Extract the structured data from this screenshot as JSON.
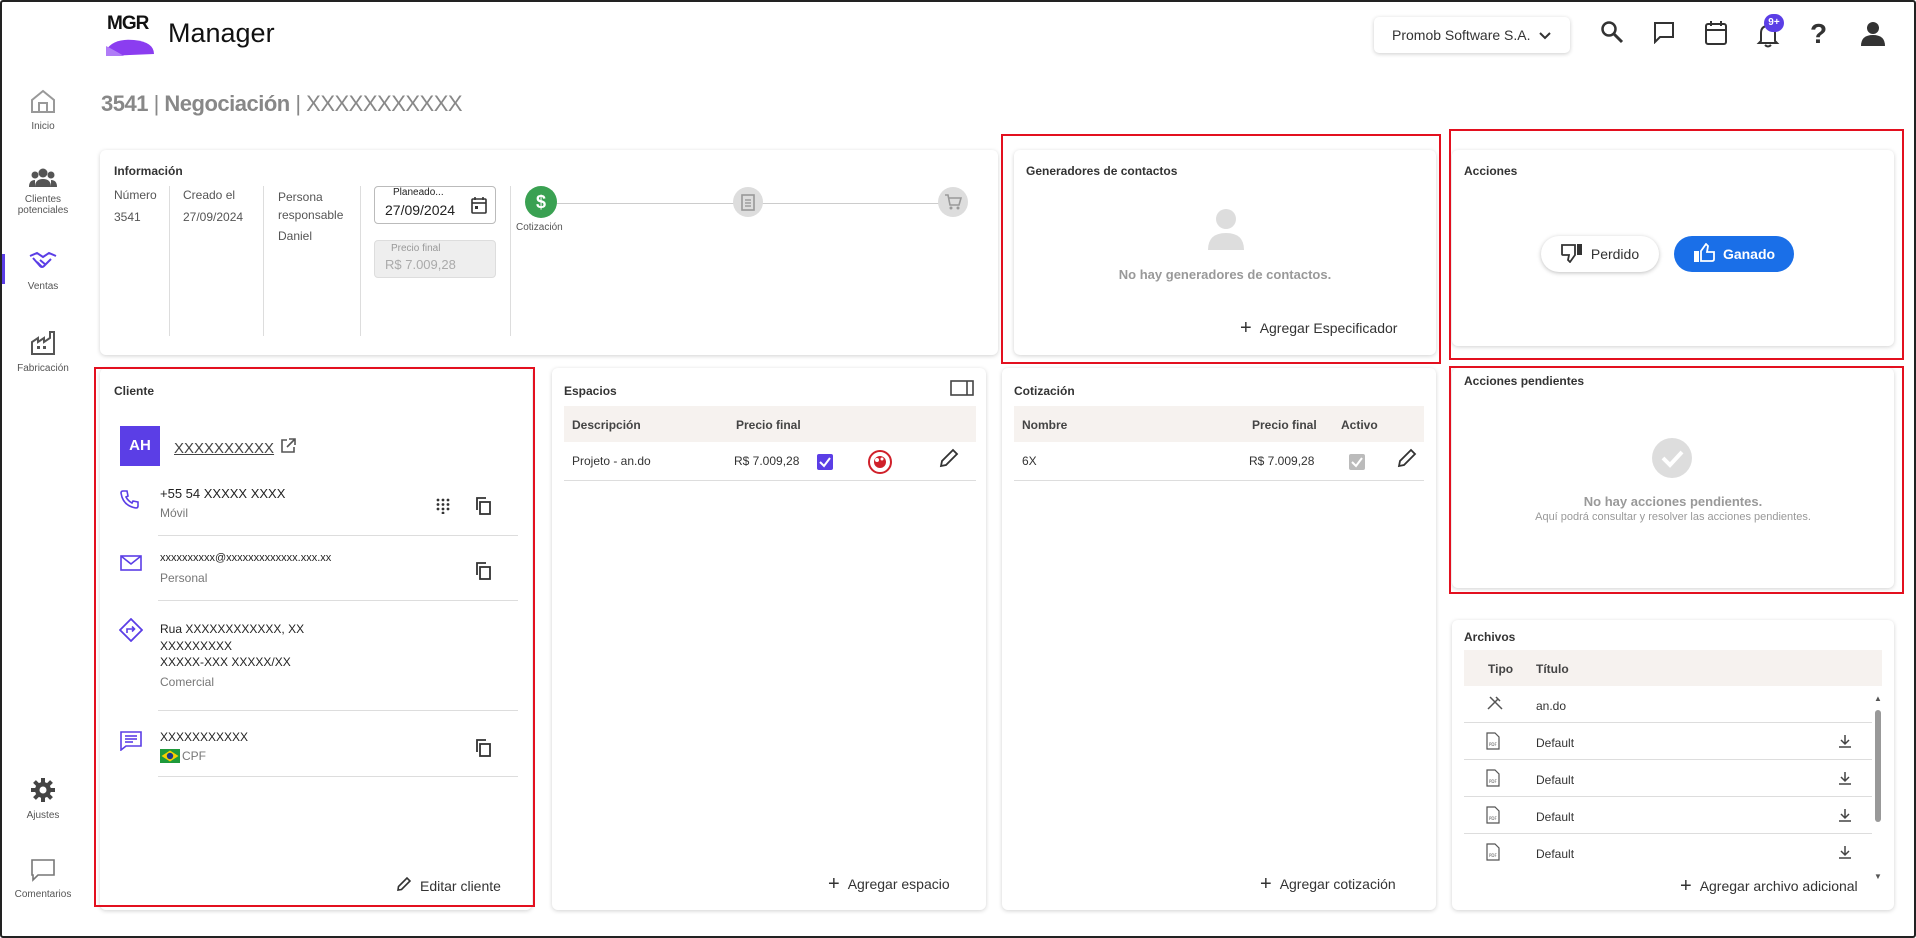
{
  "header": {
    "logo_text": "MGR",
    "app_name": "Manager",
    "company": "Promob Software S.A.",
    "notif_badge": "9+"
  },
  "sidebar": {
    "items": [
      {
        "label": "Inicio",
        "icon": "home-icon"
      },
      {
        "label": "Clientes potenciales",
        "icon": "people-icon"
      },
      {
        "label": "Ventas",
        "icon": "handshake-icon"
      },
      {
        "label": "Fabricación",
        "icon": "factory-icon"
      },
      {
        "label": "Ajustes",
        "icon": "gear-icon"
      },
      {
        "label": "Comentarios",
        "icon": "comment-icon"
      }
    ]
  },
  "page": {
    "title_num": "3541",
    "title_sep": " | ",
    "title_main": "Negociación",
    "title_name": " | XXXXXXXXXXX"
  },
  "info": {
    "title": "Información",
    "numero_label": "Número",
    "numero_val": "3541",
    "creado_label": "Creado el",
    "creado_val": "27/09/2024",
    "persona_label": "Persona responsable",
    "persona_val": "Daniel",
    "planeado_label": "Planeado...",
    "planeado_val": "27/09/2024",
    "precio_label": "Precio final",
    "precio_val": "R$ 7.009,28",
    "step_label": "Cotización"
  },
  "generadores": {
    "title": "Generadores de contactos",
    "empty": "No hay generadores de contactos.",
    "add": "Agregar Especificador"
  },
  "acciones": {
    "title": "Acciones",
    "perdido": "Perdido",
    "ganado": "Ganado"
  },
  "pendientes": {
    "title": "Acciones pendientes",
    "empty": "No hay acciones pendientes.",
    "sub": "Aquí podrá consultar y resolver las acciones pendientes."
  },
  "cliente": {
    "title": "Cliente",
    "initials": "AH",
    "name": "XXXXXXXXXX",
    "phone": "+55 54 XXXXX XXXX",
    "phone_type": "Móvil",
    "email": "xxxxxxxxxx@xxxxxxxxxxxxx.xxx.xx",
    "email_type": "Personal",
    "addr1": "Rua XXXXXXXXXXXX, XX",
    "addr2": "XXXXXXXXX",
    "addr3": "XXXXX-XXX XXXXX/XX",
    "addr_type": "Comercial",
    "doc": "XXXXXXXXXXX",
    "doc_type": "CPF",
    "edit": "Editar cliente"
  },
  "espacios": {
    "title": "Espacios",
    "col1": "Descripción",
    "col2": "Precio final",
    "rows": [
      {
        "desc": "Projeto - an.do",
        "price": "R$ 7.009,28"
      }
    ],
    "add": "Agregar espacio"
  },
  "cotizacion": {
    "title": "Cotización",
    "col1": "Nombre",
    "col2": "Precio final",
    "col3": "Activo",
    "rows": [
      {
        "name": "6X",
        "price": "R$ 7.009,28"
      }
    ],
    "add": "Agregar cotización"
  },
  "archivos": {
    "title": "Archivos",
    "col1": "Tipo",
    "col2": "Título",
    "rows": [
      {
        "title": "an.do",
        "icon": "design-file-icon"
      },
      {
        "title": "Default",
        "icon": "pdf-file-icon"
      },
      {
        "title": "Default",
        "icon": "pdf-file-icon"
      },
      {
        "title": "Default",
        "icon": "pdf-file-icon"
      },
      {
        "title": "Default",
        "icon": "pdf-file-icon"
      }
    ],
    "add": "Agregar archivo adicional"
  },
  "colors": {
    "accent": "#5b3ee6",
    "ganado": "#1a6fe8",
    "green": "#3aa152",
    "highlight": "#e3101f"
  }
}
